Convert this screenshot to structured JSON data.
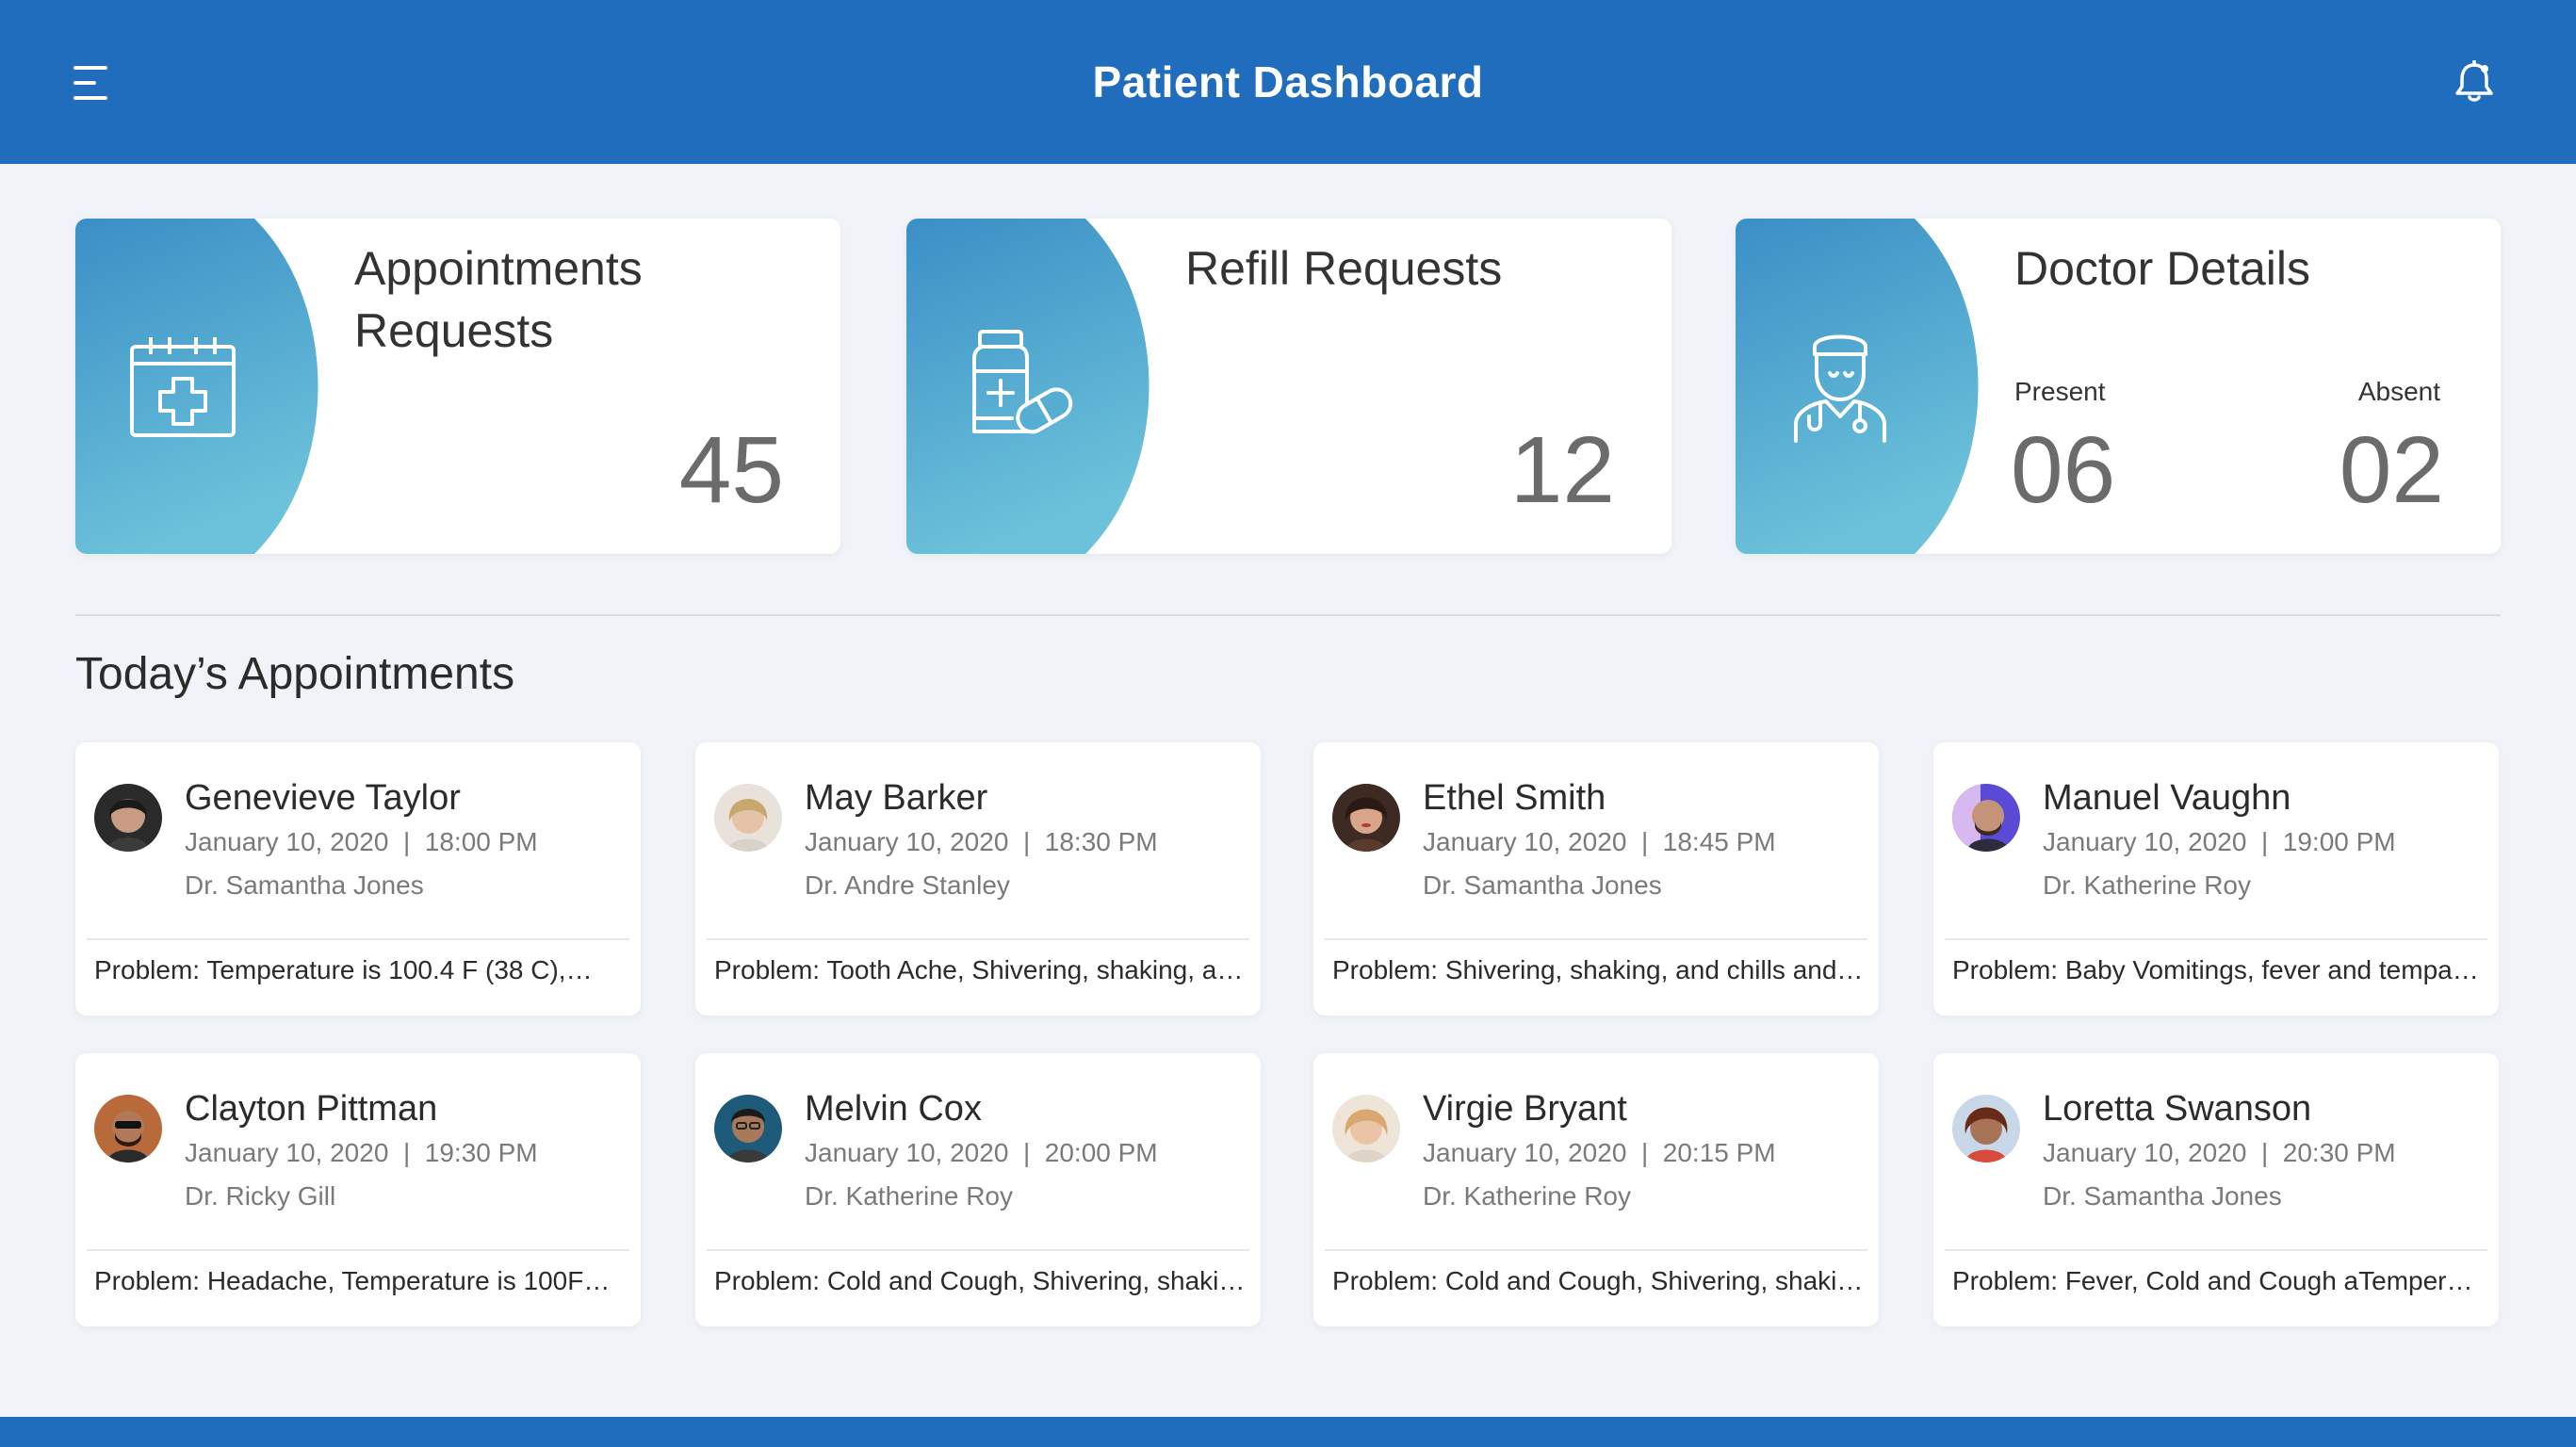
{
  "header": {
    "title": "Patient Dashboard",
    "menu_icon": "menu-icon",
    "notification_icon": "bell-icon"
  },
  "stats": {
    "appointments": {
      "title": "Appointments Requests",
      "value": "45",
      "icon": "calendar-plus-icon"
    },
    "refills": {
      "title": "Refill Requests",
      "value": "12",
      "icon": "medicine-bottle-icon"
    },
    "doctors": {
      "title": "Doctor Details",
      "present_label": "Present",
      "present_value": "06",
      "absent_label": "Absent",
      "absent_value": "02",
      "icon": "doctor-icon"
    }
  },
  "section_title": "Today’s Appointments",
  "appointments": [
    {
      "name": "Genevieve Taylor",
      "date": "January 10, 2020",
      "time": "18:00 PM",
      "datetime": "January 10, 2020  |  18:00 PM",
      "doctor": "Dr. Samantha Jones",
      "problem": "Problem: Temperature is 100.4 F (38 C),…"
    },
    {
      "name": "May Barker",
      "date": "January 10, 2020",
      "time": "18:30 PM",
      "datetime": "January 10, 2020  |  18:30 PM",
      "doctor": "Dr. Andre Stanley",
      "problem": "Problem: Tooth Ache, Shivering, shaking, a…"
    },
    {
      "name": "Ethel Smith",
      "date": "January 10, 2020",
      "time": "18:45 PM",
      "datetime": "January 10, 2020  |  18:45 PM",
      "doctor": "Dr. Samantha Jones",
      "problem": "Problem: Shivering, shaking, and chills and…"
    },
    {
      "name": "Manuel Vaughn",
      "date": "January 10, 2020",
      "time": "19:00 PM",
      "datetime": "January 10, 2020  |  19:00 PM",
      "doctor": "Dr. Katherine Roy",
      "problem": "Problem: Baby Vomitings, fever and tempa…"
    },
    {
      "name": "Clayton Pittman",
      "date": "January 10, 2020",
      "time": "19:30 PM",
      "datetime": "January 10, 2020  |  19:30 PM",
      "doctor": "Dr. Ricky Gill",
      "problem": "Problem: Headache, Temperature is 100F…"
    },
    {
      "name": "Melvin Cox",
      "date": "January 10, 2020",
      "time": "20:00 PM",
      "datetime": "January 10, 2020  |  20:00 PM",
      "doctor": "Dr. Katherine Roy",
      "problem": "Problem: Cold and Cough, Shivering, shaki…"
    },
    {
      "name": "Virgie Bryant",
      "date": "January 10, 2020",
      "time": "20:15 PM",
      "datetime": "January 10, 2020  |  20:15 PM",
      "doctor": "Dr. Katherine Roy",
      "problem": "Problem: Cold and Cough, Shivering, shaki…"
    },
    {
      "name": "Loretta Swanson",
      "date": "January 10, 2020",
      "time": "20:30 PM",
      "datetime": "January 10, 2020  |  20:30 PM",
      "doctor": "Dr. Samantha Jones",
      "problem": "Problem: Fever, Cold and Cough aTemper…"
    }
  ],
  "colors": {
    "primary": "#1f6dbc",
    "gradient_top": "#3a92c8",
    "gradient_bottom": "#6cc3dc",
    "background": "#f0f4f8"
  }
}
